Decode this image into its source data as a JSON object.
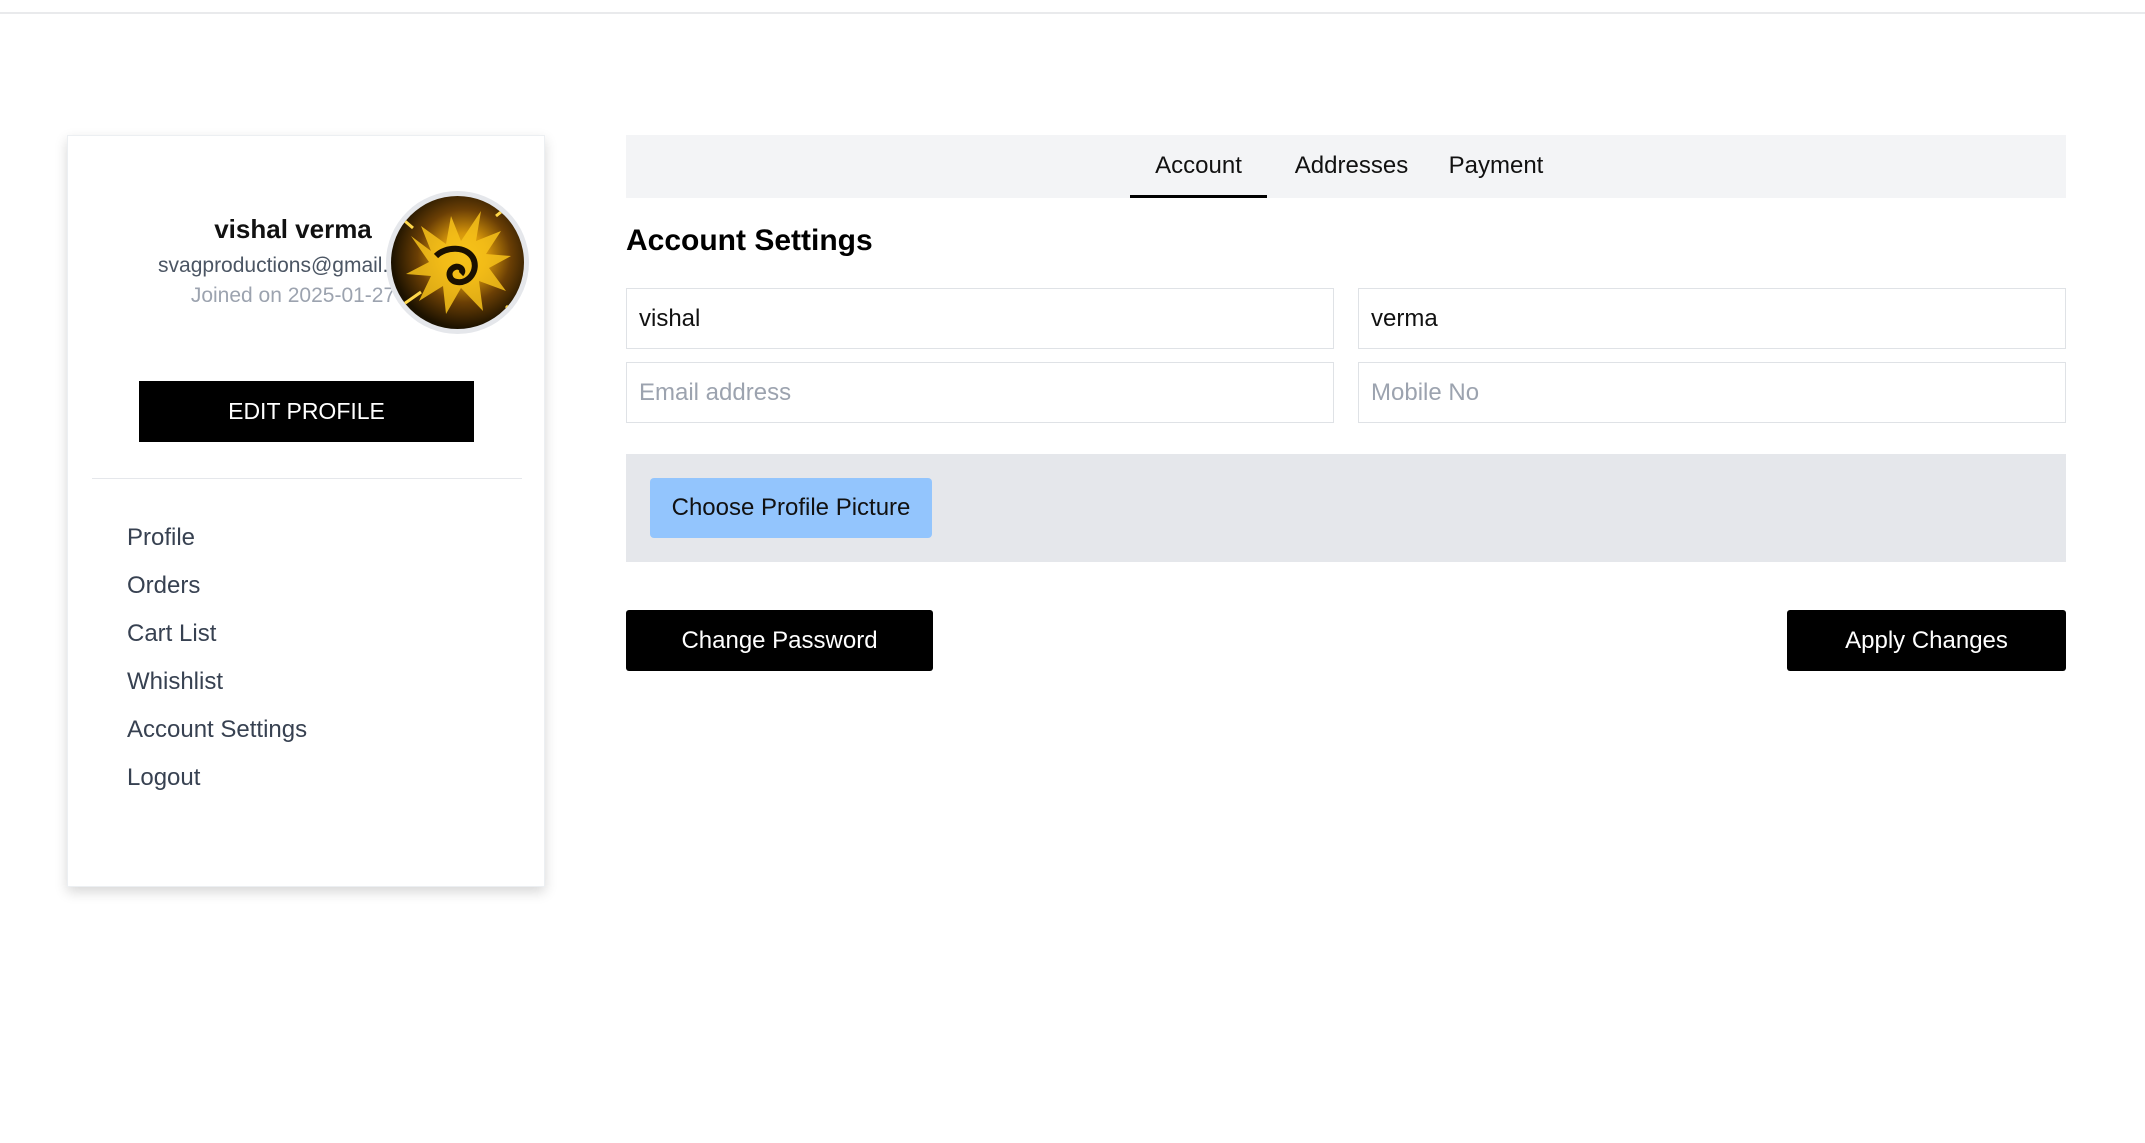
{
  "profile": {
    "name": "vishal verma",
    "email": "svagproductions@gmail.com",
    "joined": "Joined on 2025-01-27",
    "edit_label": "EDIT PROFILE"
  },
  "sidebar": {
    "items": [
      {
        "label": "Profile"
      },
      {
        "label": "Orders"
      },
      {
        "label": "Cart List"
      },
      {
        "label": "Whishlist"
      },
      {
        "label": "Account Settings"
      },
      {
        "label": "Logout"
      }
    ]
  },
  "tabs": [
    {
      "label": "Account",
      "active": true
    },
    {
      "label": "Addresses",
      "active": false
    },
    {
      "label": "Payment",
      "active": false
    }
  ],
  "account": {
    "title": "Account Settings",
    "first_name": "vishal",
    "last_name": "verma",
    "email_placeholder": "Email address",
    "mobile_placeholder": "Mobile No",
    "choose_picture_label": "Choose Profile Picture",
    "change_password_label": "Change Password",
    "apply_label": "Apply Changes"
  },
  "colors": {
    "accent_button": "#000000",
    "upload_button": "#93c5fd",
    "panel_background": "#e5e7eb"
  }
}
